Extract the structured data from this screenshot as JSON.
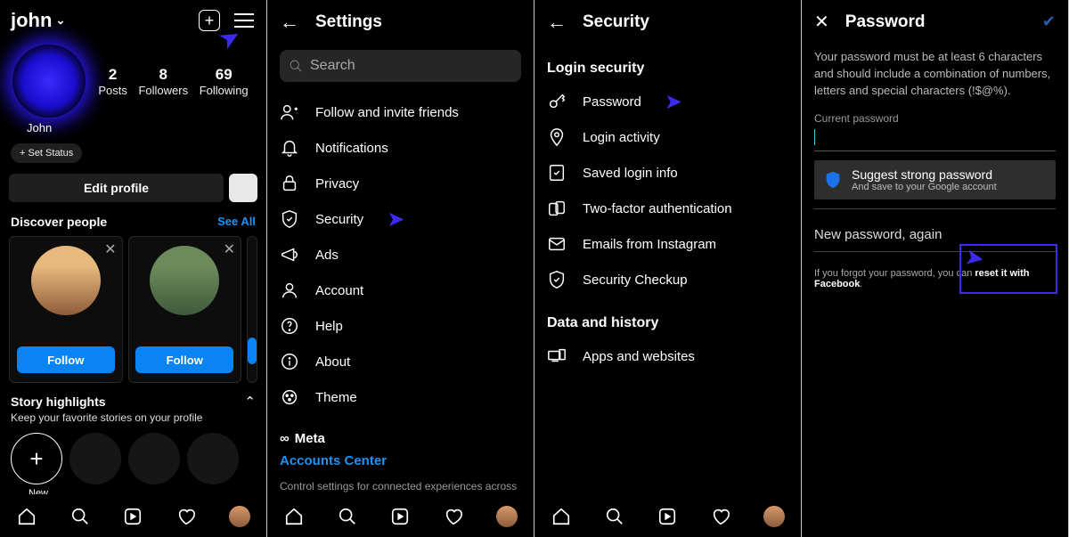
{
  "p1": {
    "username": "john",
    "stats": [
      {
        "n": "2",
        "l": "Posts"
      },
      {
        "n": "8",
        "l": "Followers"
      },
      {
        "n": "69",
        "l": "Following"
      }
    ],
    "display_name": "John",
    "set_status": "+  Set Status",
    "edit_profile": "Edit profile",
    "discover": "Discover people",
    "see_all": "See All",
    "follow": "Follow",
    "story_title": "Story highlights",
    "story_desc": "Keep your favorite stories on your profile",
    "new_label": "New"
  },
  "p2": {
    "title": "Settings",
    "search_ph": "Search",
    "items": [
      {
        "icon": "invite",
        "label": "Follow and invite friends"
      },
      {
        "icon": "bell",
        "label": "Notifications"
      },
      {
        "icon": "lock",
        "label": "Privacy"
      },
      {
        "icon": "shield",
        "label": "Security"
      },
      {
        "icon": "mega",
        "label": "Ads"
      },
      {
        "icon": "user",
        "label": "Account"
      },
      {
        "icon": "help",
        "label": "Help"
      },
      {
        "icon": "info",
        "label": "About"
      },
      {
        "icon": "theme",
        "label": "Theme"
      }
    ],
    "meta": "Meta",
    "ac": "Accounts Center",
    "desc": "Control settings for connected experiences across Instagram, the Facebook app and Messenger,"
  },
  "p3": {
    "title": "Security",
    "sect1": "Login security",
    "items1": [
      {
        "icon": "key",
        "label": "Password"
      },
      {
        "icon": "pin",
        "label": "Login activity"
      },
      {
        "icon": "saved",
        "label": "Saved login info"
      },
      {
        "icon": "2fa",
        "label": "Two-factor authentication"
      },
      {
        "icon": "mail",
        "label": "Emails from Instagram"
      },
      {
        "icon": "check",
        "label": "Security Checkup"
      }
    ],
    "sect2": "Data and history",
    "items2": [
      {
        "icon": "apps",
        "label": "Apps and websites"
      }
    ]
  },
  "p4": {
    "title": "Password",
    "hint": "Your password must be at least 6 characters and should include a combination of numbers, letters and special characters (!$@%).",
    "cur": "Current password",
    "sugg_t": "Suggest strong password",
    "sugg_d": "And save to your Google account",
    "new2": "New password, again",
    "forgot_a": "If you forgot your password, you can ",
    "forgot_b": "reset it with Facebook"
  }
}
